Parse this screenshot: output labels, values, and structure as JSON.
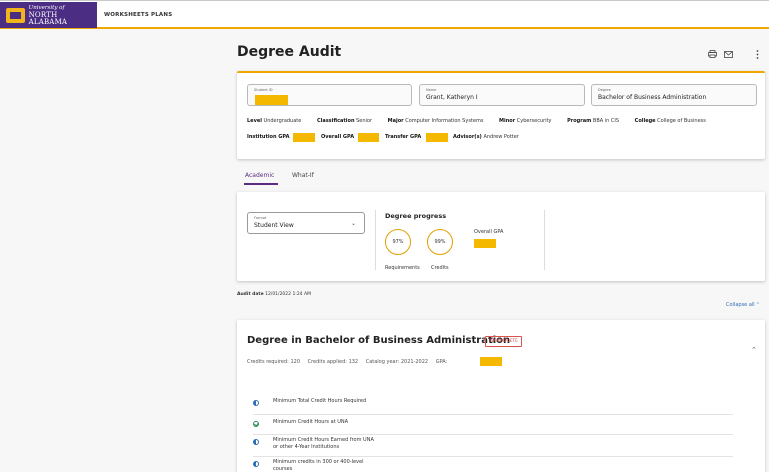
{
  "logo": {
    "line1": "University of",
    "line2": "NORTH ALABAMA",
    "colors": {
      "purple": "#4b2e83",
      "gold": "#f2b41c"
    }
  },
  "nav": {
    "worksheets": "WORKSHEETS",
    "plans": "PLANS"
  },
  "header": {
    "title": "Degree Audit",
    "icons": [
      "print-icon",
      "mail-icon",
      "more-vert-icon"
    ]
  },
  "student": {
    "id_label": "Student ID",
    "id_value": "",
    "name_label": "Name",
    "name_value": "Grant, Katheryn I",
    "degree_label": "Degree",
    "degree_value": "Bachelor of Business Administration",
    "level_label": "Level",
    "level_value": "Undergraduate",
    "classification_label": "Classification",
    "classification_value": "Senior",
    "major_label": "Major",
    "major_value": "Computer Information Systems",
    "minor_label": "Minor",
    "minor_value": "Cybersecurity",
    "program_label": "Program",
    "program_value": "BBA in CIS",
    "college_label": "College",
    "college_value": "College of Business",
    "institution_gpa_label": "Institution GPA",
    "overall_gpa_label": "Overall GPA",
    "transfer_gpa_label": "Transfer GPA",
    "advisor_label": "Advisor(s)",
    "advisor_value": "Andrew Potter"
  },
  "tabs": {
    "academic": "Academic",
    "whatif": "What-If"
  },
  "format": {
    "label": "Format",
    "value": "Student View"
  },
  "progress": {
    "title": "Degree progress",
    "requirements_pct": "97%",
    "requirements_fraction": 0.97,
    "requirements_label": "Requirements",
    "credits_pct": "99%",
    "credits_fraction": 0.99,
    "credits_label": "Credits",
    "overall_gpa_label": "Overall GPA"
  },
  "audit": {
    "date_label": "Audit date",
    "date_value": "12/01/2022 1:24 AM",
    "collapse_all": "Collapse all"
  },
  "degree_block": {
    "title": "Degree in Bachelor of Business Administration",
    "status": "INCOMPLETE",
    "credits_required_label": "Credits required:",
    "credits_required": "120",
    "credits_applied_label": "Credits applied:",
    "credits_applied": "132",
    "catalog_year_label": "Catalog year:",
    "catalog_year": "2021-2022",
    "gpa_label": "GPA:"
  },
  "requirements": [
    {
      "text": "Minimum Total Credit Hours Required",
      "icon": "half-circle-icon"
    },
    {
      "text": "Minimum Credit Hours at UNA",
      "icon": "check-circle-icon"
    },
    {
      "text": "Minimum Credit Hours Earned from UNA",
      "text2": "or other 4-Year Institutions",
      "icon": "half-circle-icon"
    },
    {
      "text": "Minimum credits in 300 or 400-level",
      "text2": "courses",
      "icon": "half-circle-icon"
    }
  ],
  "colors": {
    "accent": "#f0a800",
    "brand": "#5a2d82",
    "status_incomplete": "#d9534f",
    "redaction": "#f5b800"
  }
}
